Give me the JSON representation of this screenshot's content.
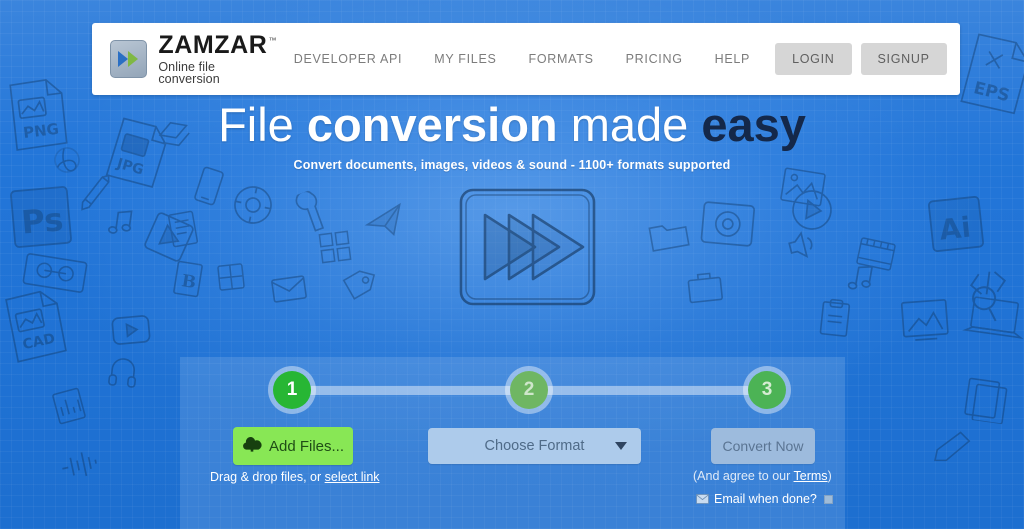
{
  "brand": {
    "name": "ZAMZAR",
    "trademark": "™",
    "tagline": "Online file conversion",
    "logo_icon": "double-chevron-icon",
    "accent_blue": "#1e73d8",
    "accent_green": "#88e755"
  },
  "nav": {
    "links": [
      {
        "label": "DEVELOPER API",
        "name": "nav-developer-api"
      },
      {
        "label": "MY FILES",
        "name": "nav-my-files"
      },
      {
        "label": "FORMATS",
        "name": "nav-formats"
      },
      {
        "label": "PRICING",
        "name": "nav-pricing"
      },
      {
        "label": "HELP",
        "name": "nav-help"
      }
    ],
    "login_label": "LOGIN",
    "signup_label": "SIGNUP"
  },
  "hero": {
    "headline_part1": "File ",
    "headline_part2": "conversion",
    "headline_part3": " made ",
    "headline_part4": "easy",
    "subheadline": "Convert documents, images, videos & sound - 1100+ formats supported",
    "art_icon": "fast-forward-play-icon"
  },
  "widget": {
    "steps": [
      {
        "number": "1",
        "name": "step-1"
      },
      {
        "number": "2",
        "name": "step-2"
      },
      {
        "number": "3",
        "name": "step-3"
      }
    ],
    "add_files_label": "Add Files...",
    "add_files_icon": "cloud-upload-icon",
    "choose_format_label": "Choose Format",
    "convert_label": "Convert Now",
    "drag_hint_prefix": "Drag & drop files, or ",
    "drag_hint_link": "select link",
    "terms_prefix": "(And agree to our ",
    "terms_link": "Terms",
    "terms_suffix": ")",
    "email_label": "Email when done?",
    "email_icon": "envelope-icon"
  },
  "background": {
    "doodle_labels": [
      "PNG",
      "JPG",
      "Ps",
      "CAD",
      "Ai",
      "EPS"
    ]
  }
}
